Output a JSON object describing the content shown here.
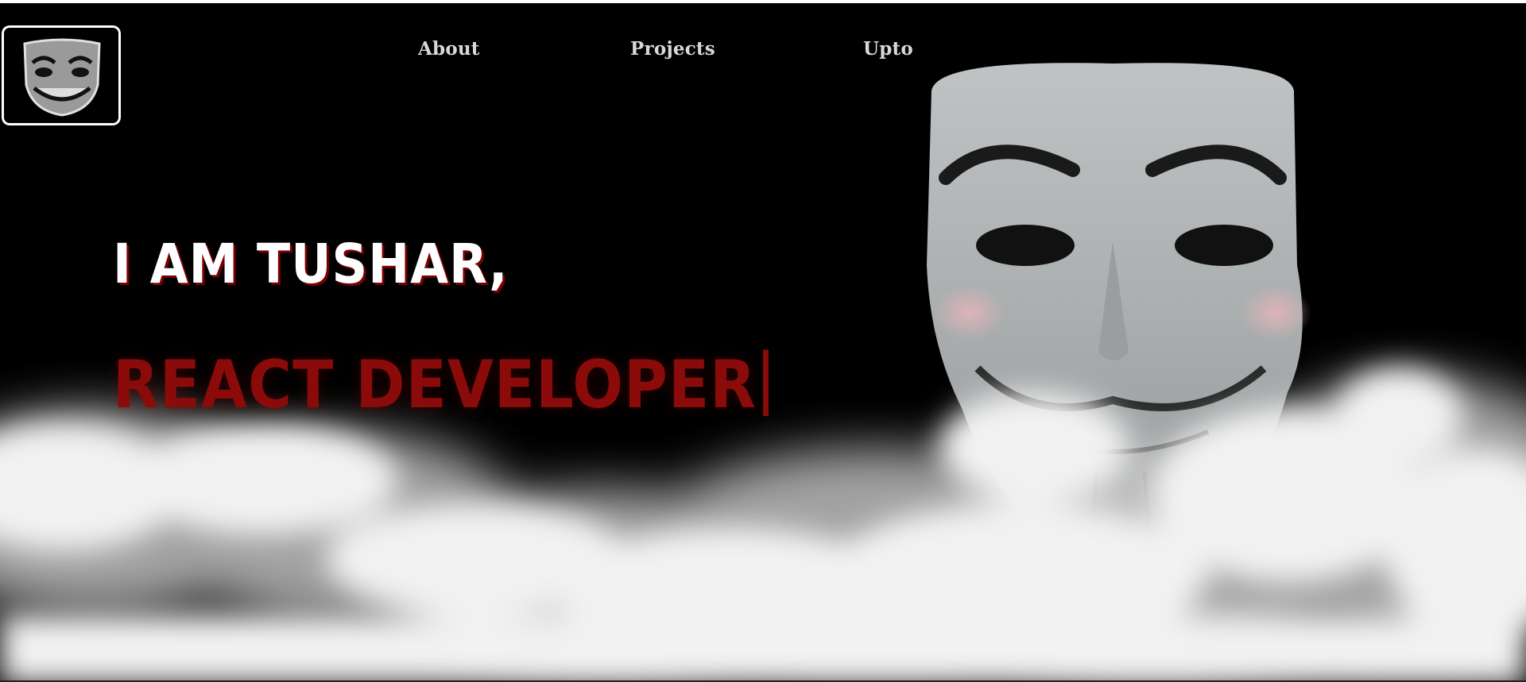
{
  "nav": {
    "about": "About",
    "projects": "Projects",
    "upto": "Upto"
  },
  "hero": {
    "line1": "I am Tushar,",
    "line2": "React Developer"
  },
  "icons": {
    "logo": "mask-logo-icon",
    "hero_image": "guy-fawkes-mask-image"
  },
  "colors": {
    "background": "#000000",
    "accent_red": "#8b0a0a",
    "text_white": "#ffffff",
    "nav_text": "#d8d8d8"
  }
}
